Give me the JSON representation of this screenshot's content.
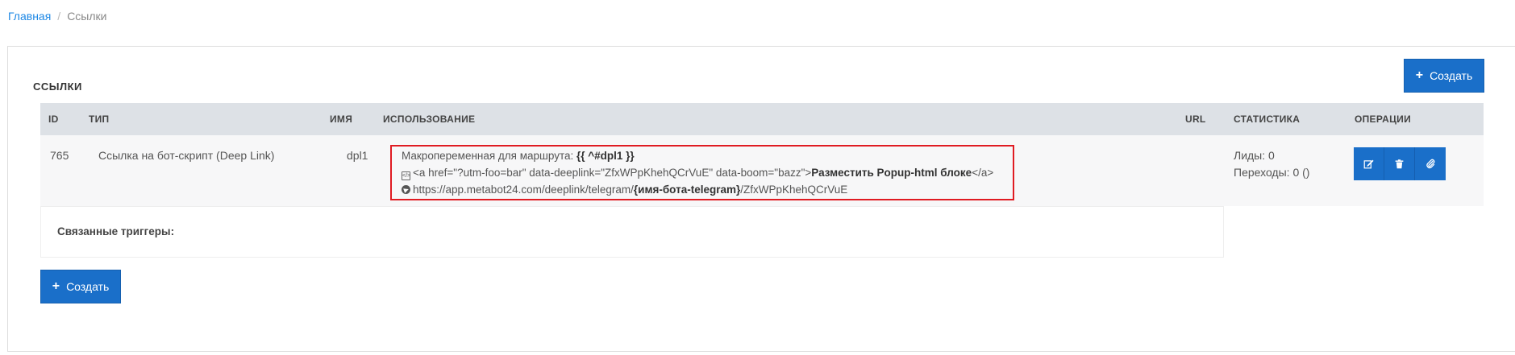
{
  "breadcrumb": {
    "home": "Главная",
    "separator": "/",
    "current": "Ссылки"
  },
  "panel": {
    "title": "ССЫЛКИ",
    "create_label": "Создать",
    "create_label_bottom": "Создать"
  },
  "table": {
    "columns": {
      "id": "ID",
      "type": "ТИП",
      "name": "ИМЯ",
      "usage": "ИСПОЛЬЗОВАНИЕ",
      "url": "URL",
      "stats": "СТАТИСТИКА",
      "ops": "ОПЕРАЦИИ"
    },
    "rows": [
      {
        "id": "765",
        "type": "Ссылка на бот-скрипт (Deep Link)",
        "name": "dpl1",
        "usage": {
          "macro_prefix": "Макропеременная для маршрута: ",
          "macro_value": "{{ ^#dpl1 }}",
          "html_prefix": "<a href=\"?utm-foo=bar\" data-deeplink=\"ZfxWPpKhehQCrVuE\" data-boom=\"bazz\">",
          "html_bold": "Разместить Popup-html блоке",
          "html_suffix": "</a>",
          "tg_prefix": "https://app.metabot24.com/deeplink/telegram/",
          "tg_bold": "{имя-бота-telegram}",
          "tg_suffix": "/ZfxWPpKhehQCrVuE"
        },
        "url": "",
        "stats": {
          "leads": "Лиды: 0",
          "transitions": "Переходы: 0 ()"
        }
      }
    ]
  },
  "triggers": {
    "label": "Связанные триггеры:"
  },
  "icons": {
    "op1": "edit-icon",
    "op2": "trash-icon",
    "op3": "paperclip-icon",
    "code": "code-file-icon",
    "telegram": "telegram-icon"
  },
  "colors": {
    "primary": "#1a6fc9",
    "link": "#1e88e5",
    "highlight_border": "#e01b22",
    "header_bg": "#dde1e6"
  }
}
